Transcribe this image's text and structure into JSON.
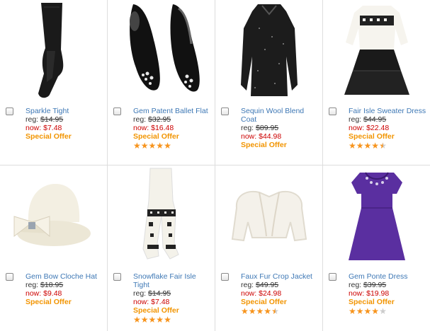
{
  "products": [
    {
      "name": "Sparkle Tight",
      "reg_label": "reg:",
      "reg_price": "$14.95",
      "now_label": "now:",
      "now_price": "$7.48",
      "offer": "Special Offer",
      "rating": null
    },
    {
      "name": "Gem Patent Ballet Flat",
      "reg_label": "reg:",
      "reg_price": "$32.95",
      "now_label": "now:",
      "now_price": "$16.48",
      "offer": "Special Offer",
      "rating": 5
    },
    {
      "name": "Sequin Wool Blend Coat",
      "reg_label": "reg:",
      "reg_price": "$89.95",
      "now_label": "now:",
      "now_price": "$44.98",
      "offer": "Special Offer",
      "rating": null
    },
    {
      "name": "Fair Isle Sweater Dress",
      "reg_label": "reg:",
      "reg_price": "$44.95",
      "now_label": "now:",
      "now_price": "$22.48",
      "offer": "Special Offer",
      "rating": 4.5
    },
    {
      "name": "Gem Bow Cloche Hat",
      "reg_label": "reg:",
      "reg_price": "$18.95",
      "now_label": "now:",
      "now_price": "$9.48",
      "offer": "Special Offer",
      "rating": null
    },
    {
      "name": "Snowflake Fair Isle Tight",
      "reg_label": "reg:",
      "reg_price": "$14.95",
      "now_label": "now:",
      "now_price": "$7.48",
      "offer": "Special Offer",
      "rating": 5
    },
    {
      "name": "Faux Fur Crop Jacket",
      "reg_label": "reg:",
      "reg_price": "$49.95",
      "now_label": "now:",
      "now_price": "$24.98",
      "offer": "Special Offer",
      "rating": 4.5
    },
    {
      "name": "Gem Ponte Dress",
      "reg_label": "reg:",
      "reg_price": "$39.95",
      "now_label": "now:",
      "now_price": "$19.98",
      "offer": "Special Offer",
      "rating": 4
    }
  ],
  "colors": {
    "link": "#3e78b5",
    "sale": "#cc0000",
    "offer": "#f29400",
    "star": "#f7941d",
    "star_empty": "#cccccc"
  },
  "images": [
    "black-tights-image",
    "patent-ballet-flats-image",
    "sequin-coat-image",
    "fair-isle-sweater-dress-image",
    "cloche-hat-image",
    "snowflake-tights-image",
    "faux-fur-jacket-image",
    "purple-ponte-dress-image"
  ]
}
